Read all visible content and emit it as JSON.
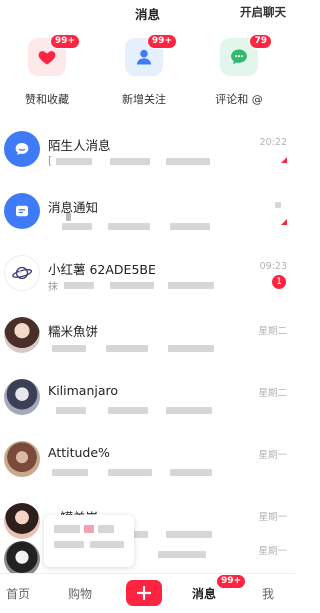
{
  "header": {
    "title": "消息",
    "action": "开启聊天"
  },
  "quick_entries": [
    {
      "label": "赞和收藏",
      "badge": "99+",
      "icon": "heart-icon"
    },
    {
      "label": "新增关注",
      "badge": "99+",
      "icon": "person-icon"
    },
    {
      "label": "评论和 @",
      "badge": "79",
      "icon": "chat-bubble-icon"
    }
  ],
  "messages": [
    {
      "name": "陌生人消息",
      "time": "20:22",
      "preview_prefix": "[",
      "icon": "chat-bubble-icon"
    },
    {
      "name": "消息通知",
      "time": "",
      "icon": "notification-icon"
    },
    {
      "name": "小红薯 62ADE5BE",
      "time": "09:23",
      "badge": "1",
      "preview_prefix": "抹",
      "icon": "planet-icon"
    },
    {
      "name": "糯米魚饼",
      "time": "星期二",
      "icon": "avatar-photo"
    },
    {
      "name": "Kilimanjaro",
      "time": "星期二",
      "icon": "avatar-photo"
    },
    {
      "name": "Attitude%",
      "time": "星期一",
      "icon": "avatar-photo"
    },
    {
      "name": "一罐羊崽",
      "time": "星期一",
      "icon": "avatar-photo"
    },
    {
      "name": "",
      "time": "星期一",
      "icon": "avatar-photo"
    }
  ],
  "bottom_nav": {
    "items": [
      "首页",
      "购物",
      "消息",
      "我"
    ],
    "active": "消息",
    "badge": "99+",
    "plus_icon": "plus-icon"
  },
  "colors": {
    "accent": "#ff2442",
    "blue": "#3f7bf6",
    "green": "#2dbb6e"
  }
}
